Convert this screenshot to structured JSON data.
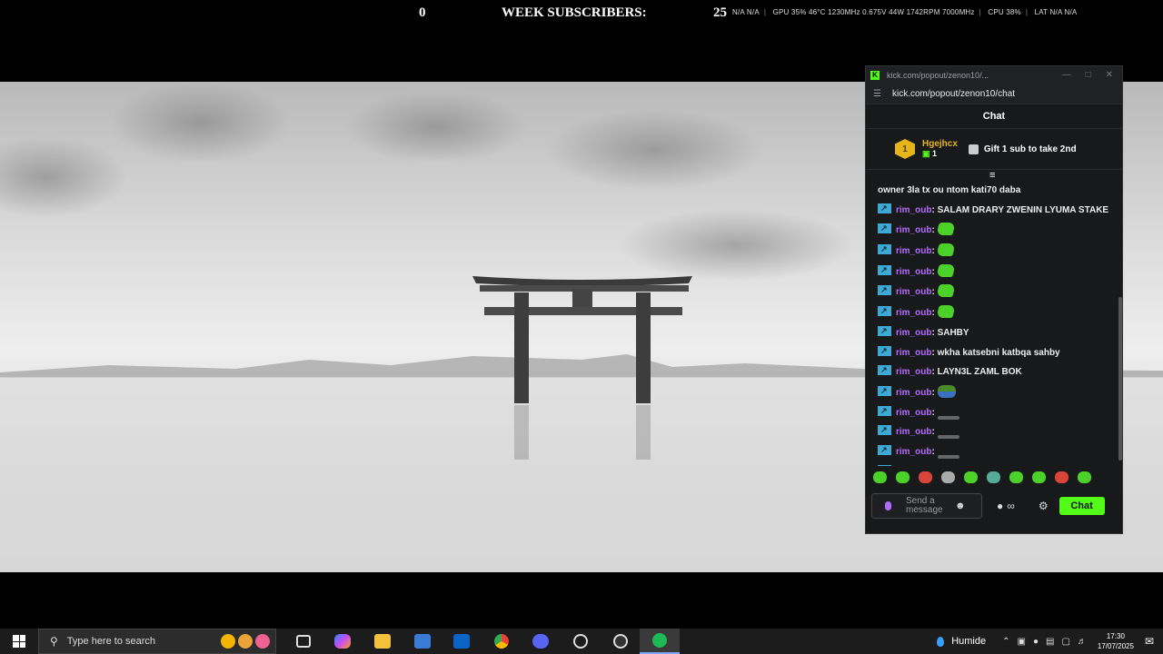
{
  "overlay": {
    "left_value": "0",
    "subs_label": "WEEK SUBSCRIBERS:",
    "subs_value": "25",
    "hwmon": [
      "N/A N/A",
      "GPU 35% 46°C 1230MHz 0.675V 44W 1742RPM 7000MHz",
      "CPU 38%",
      "LAT N/A N/A"
    ]
  },
  "popup": {
    "window_title": "kick.com/popout/zenon10/...",
    "url": "kick.com/popout/zenon10/chat",
    "chat_title": "Chat",
    "gift": {
      "rank": "1",
      "username": "Hgejhcx",
      "count": "1",
      "action": "Gift 1 sub to take 2nd"
    },
    "messages": [
      {
        "user": "",
        "text": "owner 3la tx ou ntom kati70 daba",
        "kind": "cont"
      },
      {
        "user": "rim_oub",
        "text": "SALAM DRARY ZWENIN LYUMA STAKE",
        "kind": "text"
      },
      {
        "user": "rim_oub",
        "text": "",
        "kind": "emote"
      },
      {
        "user": "rim_oub",
        "text": "",
        "kind": "emote"
      },
      {
        "user": "rim_oub",
        "text": "",
        "kind": "emote"
      },
      {
        "user": "rim_oub",
        "text": "",
        "kind": "emote"
      },
      {
        "user": "rim_oub",
        "text": "",
        "kind": "emote"
      },
      {
        "user": "rim_oub",
        "text": "SAHBY",
        "kind": "text"
      },
      {
        "user": "rim_oub",
        "text": "wkha katsebni katbqa sahby",
        "kind": "text"
      },
      {
        "user": "rim_oub",
        "text": "LAYN3L ZAML BOK",
        "kind": "text"
      },
      {
        "user": "rim_oub",
        "text": "",
        "kind": "emote2"
      },
      {
        "user": "rim_oub",
        "text": "",
        "kind": "ghost"
      },
      {
        "user": "rim_oub",
        "text": "",
        "kind": "ghost"
      },
      {
        "user": "rim_oub",
        "text": "",
        "kind": "ghost"
      },
      {
        "user": "rim_oub",
        "text": "",
        "kind": "ghost"
      }
    ],
    "input_placeholder": "Send a message",
    "send_label": "Chat",
    "colors": {
      "kick_green": "#53fc18",
      "username": "#b36bff",
      "badge": "#3fa9d6",
      "gold": "#e5b418"
    }
  },
  "taskbar": {
    "search_placeholder": "Type here to search",
    "apps": [
      "task-view-icon",
      "copilot-icon",
      "file-explorer-icon",
      "store-icon",
      "outlook-icon",
      "chrome-icon",
      "discord-icon",
      "app-icon",
      "obs-icon",
      "spotify-icon"
    ],
    "weather": "Humide",
    "time": "17:30",
    "date": "17/07/2025"
  }
}
